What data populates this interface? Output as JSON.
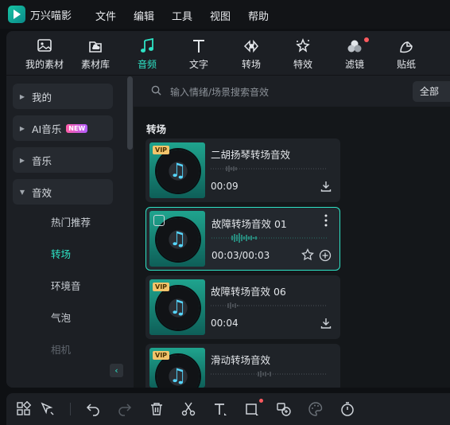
{
  "app": {
    "name": "万兴喵影"
  },
  "menu": [
    "文件",
    "编辑",
    "工具",
    "视图",
    "帮助"
  ],
  "tabs": [
    {
      "label": "我的素材",
      "icon": "my-media-icon"
    },
    {
      "label": "素材库",
      "icon": "stock-cloud-icon"
    },
    {
      "label": "音频",
      "icon": "music-note-icon",
      "active": true
    },
    {
      "label": "文字",
      "icon": "text-icon"
    },
    {
      "label": "转场",
      "icon": "transition-icon"
    },
    {
      "label": "特效",
      "icon": "effects-icon"
    },
    {
      "label": "滤镜",
      "icon": "filter-icon",
      "badge_dot": true
    },
    {
      "label": "贴纸",
      "icon": "sticker-icon"
    }
  ],
  "sidebar": {
    "groups": [
      {
        "label": "我的",
        "expanded": false
      },
      {
        "label": "AI音乐",
        "badge": "NEW",
        "expanded": false
      },
      {
        "label": "音乐",
        "expanded": false
      },
      {
        "label": "音效",
        "expanded": true
      }
    ],
    "subitems": [
      {
        "label": "热门推荐"
      },
      {
        "label": "转场",
        "active": true
      },
      {
        "label": "环境音"
      },
      {
        "label": "气泡"
      },
      {
        "label": "相机"
      }
    ]
  },
  "search": {
    "placeholder": "输入情绪/场景搜索音效",
    "filter": "全部"
  },
  "section": {
    "title": "转场"
  },
  "cards": [
    {
      "title": "二胡扬琴转场音效",
      "time": "00:09",
      "vip": true,
      "action": "download"
    },
    {
      "title": "故障转场音效 01",
      "time": "00:03/00:03",
      "vip": false,
      "selected": true,
      "action": "add"
    },
    {
      "title": "故障转场音效 06",
      "time": "00:04",
      "vip": true,
      "action": "download"
    },
    {
      "title": "滑动转场音效",
      "time": "",
      "vip": true,
      "action": "download"
    }
  ],
  "badges": {
    "vip": "VIP"
  },
  "colors": {
    "accent": "#2ee3c5",
    "vip": "#f2c46b",
    "notify": "#ff5a5f"
  }
}
